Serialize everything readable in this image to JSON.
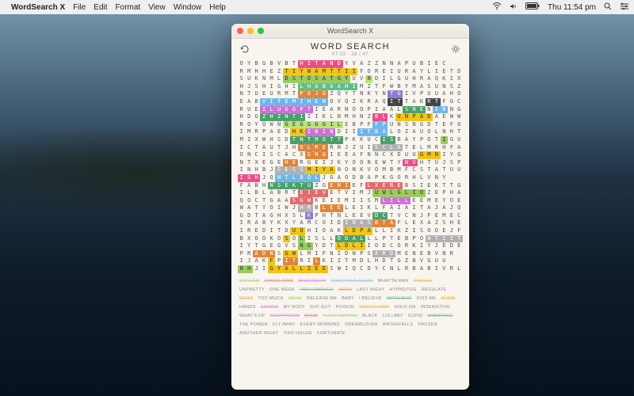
{
  "menubar": {
    "apple": "",
    "app": "WordSearch X",
    "items": [
      "File",
      "Edit",
      "Format",
      "View",
      "Window",
      "Help"
    ],
    "right": [
      "Thu 11:54 pm"
    ]
  },
  "window": {
    "title": "WordSearch X"
  },
  "header": {
    "title": "WORD SEARCH",
    "stats": "07:32  ·  28 / 47"
  },
  "grid_cols": 30,
  "grid": [
    "OYBGBVBTHITANDYVAZZNNAPUBIEC",
    "RMHHEZTIYWAMTTIIFOREIURAYLIETD",
    "SUKNMLDSTOSATGYUVNDILGUHRAQKIX",
    "HJSHIGHILHABAAHIMZTFWBYMASUNSZYD",
    "NTUEURMTPOJGZQYTNKYNTGIVPUUAHO",
    "EABVITEMIHENOVQZKRAQITTAKRTFGCP",
    "RUEILUGOPTIEARNOOPIAALSNENIBNGGW",
    "HDGZHZNTIIIKLNMHNZBLKUNPADAEWW",
    "ROYOWNGEGGGGILEBPFFPUNSNGDTEFOC",
    "IMRPAEDHKIBINDIIITBALOZAUOLNHTPA",
    "MIXWHSDTNTMOTTPKKUCISBAYPOTIGUL",
    "ICTAUTJHOLRERNJZUISCLATELMRHFACU",
    "ONCISCACXSNGIEEAFNNCXDUUGMNIYGHTL",
    "NTXEGEHERGEIJKYOONEWTYNVHTUJSPA",
    "INHBJSESSMIYANONKVOMBMFCSTATUUB",
    "ISHJQNTLBOLJGAODBAPKGORHLVNY",
    "FABHNSEKTUZGENIEFLXEREBSIEKTTG",
    "ILBLABRTEIEVETVIMJUWLGLIOZEPHARXXM",
    "QOCTGAASGWKEIEMIISMLILLEEMEYOEZH",
    "WATYOIWJHRBLEELEIKLFAIAITAJAJQERG",
    "GDTAGHXSLKPHTNLEEVDCTVCNJFEMECSXX",
    "IRABYKXYAMCOIDINASBTAFLEXAZSHEKF",
    "IREDITDUOHIOAKLDPALLIKZISOOEJF",
    "BXOOKOSOLISLLODALLLPTEBPONTIITU",
    "IYTGEGVSNGYDTLDLIIODCORKIYJEDEF",
    "PRADNSGWLMIFNIDNPSARDMENEBVNR",
    "IJAKFPITRILKIZTMDLHDTGZBVGUU",
    "NHJIGYALLZEESWIQCDYCNLRBABIVRL"
  ],
  "highlights": [
    {
      "r": 0,
      "c": 8,
      "len": 6,
      "bg": "#e84f8a",
      "fg": "#fff"
    },
    {
      "r": 1,
      "c": 6,
      "len": 10,
      "bg": "#f0c419",
      "fg": "#333"
    },
    {
      "r": 2,
      "c": 6,
      "len": 9,
      "bg": "#9acb5f",
      "fg": "#333"
    },
    {
      "r": 2,
      "c": 17,
      "len": 1,
      "bg": "#b9e27a",
      "fg": "#333"
    },
    {
      "r": 3,
      "c": 8,
      "len": 8,
      "bg": "#5bbf8b",
      "fg": "#fff"
    },
    {
      "r": 4,
      "c": 8,
      "len": 4,
      "bg": "#e0843a",
      "fg": "#fff"
    },
    {
      "r": 4,
      "c": 20,
      "len": 2,
      "bg": "#8a7dcf",
      "fg": "#fff"
    },
    {
      "r": 5,
      "c": 3,
      "len": 9,
      "bg": "#6fb6e8",
      "fg": "#fff"
    },
    {
      "r": 5,
      "c": 20,
      "len": 2,
      "bg": "#444",
      "fg": "#fff"
    },
    {
      "r": 5,
      "c": 25,
      "len": 2,
      "bg": "#444",
      "fg": "#fff"
    },
    {
      "r": 6,
      "c": 3,
      "len": 7,
      "bg": "#cf6fd6",
      "fg": "#fff"
    },
    {
      "r": 6,
      "c": 22,
      "len": 3,
      "bg": "#49a06a",
      "fg": "#fff"
    },
    {
      "r": 6,
      "c": 26,
      "len": 2,
      "bg": "#6fb6e8",
      "fg": "#fff"
    },
    {
      "r": 7,
      "c": 3,
      "len": 6,
      "bg": "#49a06a",
      "fg": "#fff"
    },
    {
      "r": 7,
      "c": 18,
      "len": 2,
      "bg": "#e84f8a",
      "fg": "#fff"
    },
    {
      "r": 7,
      "c": 21,
      "len": 5,
      "bg": "#f0c419",
      "fg": "#333"
    },
    {
      "r": 8,
      "c": 6,
      "len": 8,
      "bg": "#b9e27a",
      "fg": "#333"
    },
    {
      "r": 8,
      "c": 18,
      "len": 2,
      "bg": "#6fb6e8",
      "fg": "#fff"
    },
    {
      "r": 9,
      "c": 7,
      "len": 2,
      "bg": "#f0c419",
      "fg": "#333"
    },
    {
      "r": 9,
      "c": 9,
      "len": 4,
      "bg": "#cf6fd6",
      "fg": "#fff"
    },
    {
      "r": 9,
      "c": 16,
      "len": 4,
      "bg": "#6fb6e8",
      "fg": "#fff"
    },
    {
      "r": 10,
      "c": 7,
      "len": 7,
      "bg": "#49a06a",
      "fg": "#fff"
    },
    {
      "r": 10,
      "c": 19,
      "len": 2,
      "bg": "#49a06a",
      "fg": "#fff"
    },
    {
      "r": 10,
      "c": 27,
      "len": 1,
      "bg": "#9acb5f",
      "fg": "#333"
    },
    {
      "r": 11,
      "c": 8,
      "len": 4,
      "bg": "#e0843a",
      "fg": "#fff"
    },
    {
      "r": 11,
      "c": 18,
      "len": 4,
      "bg": "#b0b0b0",
      "fg": "#fff"
    },
    {
      "r": 12,
      "c": 9,
      "len": 3,
      "bg": "#e0843a",
      "fg": "#fff"
    },
    {
      "r": 12,
      "c": 24,
      "len": 3,
      "bg": "#f0c419",
      "fg": "#333"
    },
    {
      "r": 13,
      "c": 6,
      "len": 2,
      "bg": "#e0843a",
      "fg": "#fff"
    },
    {
      "r": 13,
      "c": 22,
      "len": 2,
      "bg": "#e84f8a",
      "fg": "#fff"
    },
    {
      "r": 14,
      "c": 5,
      "len": 4,
      "bg": "#b0b0b0",
      "fg": "#fff"
    },
    {
      "r": 14,
      "c": 9,
      "len": 4,
      "bg": "#f0c419",
      "fg": "#333"
    },
    {
      "r": 15,
      "c": 0,
      "len": 3,
      "bg": "#e84f8a",
      "fg": "#fff"
    },
    {
      "r": 15,
      "c": 5,
      "len": 6,
      "bg": "#6fb6e8",
      "fg": "#fff"
    },
    {
      "r": 16,
      "c": 4,
      "len": 6,
      "bg": "#49a06a",
      "fg": "#fff"
    },
    {
      "r": 16,
      "c": 12,
      "len": 3,
      "bg": "#e0843a",
      "fg": "#fff"
    },
    {
      "r": 16,
      "c": 17,
      "len": 5,
      "bg": "#e26b6b",
      "fg": "#fff"
    },
    {
      "r": 17,
      "c": 8,
      "len": 4,
      "bg": "#e26b6b",
      "fg": "#fff"
    },
    {
      "r": 17,
      "c": 18,
      "len": 7,
      "bg": "#9acb5f",
      "fg": "#333"
    },
    {
      "r": 18,
      "c": 7,
      "len": 3,
      "bg": "#e26b6b",
      "fg": "#fff"
    },
    {
      "r": 18,
      "c": 19,
      "len": 4,
      "bg": "#cf6fd6",
      "fg": "#fff"
    },
    {
      "r": 19,
      "c": 8,
      "len": 2,
      "bg": "#b0b0b0",
      "fg": "#fff"
    },
    {
      "r": 19,
      "c": 11,
      "len": 3,
      "bg": "#e0843a",
      "fg": "#fff"
    },
    {
      "r": 20,
      "c": 9,
      "len": 1,
      "bg": "#8a7dcf",
      "fg": "#fff"
    },
    {
      "r": 20,
      "c": 18,
      "len": 2,
      "bg": "#49a06a",
      "fg": "#fff"
    },
    {
      "r": 21,
      "c": 14,
      "len": 4,
      "bg": "#b0b0b0",
      "fg": "#fff"
    },
    {
      "r": 21,
      "c": 18,
      "len": 3,
      "bg": "#e0843a",
      "fg": "#fff"
    },
    {
      "r": 22,
      "c": 7,
      "len": 2,
      "bg": "#f0c419",
      "fg": "#333"
    },
    {
      "r": 22,
      "c": 14,
      "len": 4,
      "bg": "#f0c419",
      "fg": "#333"
    },
    {
      "r": 23,
      "c": 6,
      "len": 1,
      "bg": "#f0c419",
      "fg": "#333"
    },
    {
      "r": 23,
      "c": 8,
      "len": 1,
      "bg": "#9acb5f",
      "fg": "#333"
    },
    {
      "r": 23,
      "c": 13,
      "len": 4,
      "bg": "#49a06a",
      "fg": "#fff"
    },
    {
      "r": 23,
      "c": 25,
      "len": 5,
      "bg": "#b0b0b0",
      "fg": "#fff"
    },
    {
      "r": 24,
      "c": 8,
      "len": 2,
      "bg": "#9acb5f",
      "fg": "#333"
    },
    {
      "r": 24,
      "c": 13,
      "len": 4,
      "bg": "#f0c419",
      "fg": "#333"
    },
    {
      "r": 25,
      "c": 2,
      "len": 3,
      "bg": "#e0843a",
      "fg": "#fff"
    },
    {
      "r": 25,
      "c": 6,
      "len": 2,
      "bg": "#f0c419",
      "fg": "#333"
    },
    {
      "r": 25,
      "c": 18,
      "len": 3,
      "bg": "#b0b0b0",
      "fg": "#fff"
    },
    {
      "r": 26,
      "c": 4,
      "len": 1,
      "bg": "#f0c419",
      "fg": "#333"
    },
    {
      "r": 26,
      "c": 6,
      "len": 2,
      "bg": "#e0843a",
      "fg": "#fff"
    },
    {
      "r": 26,
      "c": 10,
      "len": 1,
      "bg": "#e0843a",
      "fg": "#fff"
    },
    {
      "r": 27,
      "c": 0,
      "len": 2,
      "bg": "#9acb5f",
      "fg": "#333"
    },
    {
      "r": 27,
      "c": 4,
      "len": 8,
      "bg": "#f0c419",
      "fg": "#333"
    }
  ],
  "words": [
    {
      "t": "SCREAM",
      "found": true,
      "c": "#9acb5f"
    },
    {
      "t": "CANDY RAIN",
      "found": true,
      "c": "#e26b6b"
    },
    {
      "t": "WILD NIGHT",
      "found": true,
      "c": "#cf6fd6"
    },
    {
      "t": "TOGETHER AGAIN",
      "found": true,
      "c": "#6fb6e8"
    },
    {
      "t": "WHATTA MAN",
      "found": false
    },
    {
      "t": "ANGELS",
      "found": true,
      "c": "#f0a030"
    },
    {
      "t": "UNPRETTY",
      "found": false
    },
    {
      "t": "ONE WEEK",
      "found": false
    },
    {
      "t": "HIGH ENOUGH",
      "found": true,
      "c": "#49a06a"
    },
    {
      "t": "HOOK",
      "found": true,
      "c": "#e0843a"
    },
    {
      "t": "LAST NIGHT",
      "found": false
    },
    {
      "t": "HYPNOTIZE",
      "found": false
    },
    {
      "t": "REGULATE",
      "found": false
    },
    {
      "t": "DITTY",
      "found": true,
      "c": "#f0a030"
    },
    {
      "t": "TOO MUCH",
      "found": false
    },
    {
      "t": "WEAK",
      "found": true,
      "c": "#9acb5f"
    },
    {
      "t": "RELEASE ME",
      "found": false
    },
    {
      "t": "BABY",
      "found": false
    },
    {
      "t": "I BELIEVE",
      "found": false
    },
    {
      "t": "IMPULSIVE",
      "found": true,
      "c": "#49a06a"
    },
    {
      "t": "KISS ME",
      "found": false
    },
    {
      "t": "SHINE",
      "found": true,
      "c": "#f0a030"
    },
    {
      "t": "HANDS",
      "found": false
    },
    {
      "t": "ZOMBIE",
      "found": true,
      "c": "#cf6fd6"
    },
    {
      "t": "MY BODY",
      "found": false
    },
    {
      "t": "SHY GUY",
      "found": false
    },
    {
      "t": "POISON",
      "found": false
    },
    {
      "t": "SWEET LADY",
      "found": true,
      "c": "#f0a030"
    },
    {
      "t": "HOLD ON",
      "found": false
    },
    {
      "t": "INSENSITIVE",
      "found": false
    },
    {
      "t": "WHAT'S UP",
      "found": false
    },
    {
      "t": "TEMPTATION",
      "found": true,
      "c": "#cf6fd6"
    },
    {
      "t": "MIAMI",
      "found": true,
      "c": "#e26b6b"
    },
    {
      "t": "TUBTHUMPING",
      "found": true,
      "c": "#9acb5f"
    },
    {
      "t": "BLACK",
      "found": false
    },
    {
      "t": "LULLABY",
      "found": false
    },
    {
      "t": "CUPID",
      "found": false
    },
    {
      "t": "SABOTAGE",
      "found": true,
      "c": "#49a06a"
    },
    {
      "t": "THE POWER",
      "found": false
    },
    {
      "t": "FLY AWAY",
      "found": false
    },
    {
      "t": "EVERY MORNING",
      "found": false
    },
    {
      "t": "DREAMLOVER",
      "found": false
    },
    {
      "t": "WATERFALLS",
      "found": false
    },
    {
      "t": "FROZEN",
      "found": false
    },
    {
      "t": "ANOTHER NIGHT",
      "found": false
    },
    {
      "t": "THIS HOUSE",
      "found": false
    },
    {
      "t": "FORTUNATE",
      "found": false
    }
  ]
}
